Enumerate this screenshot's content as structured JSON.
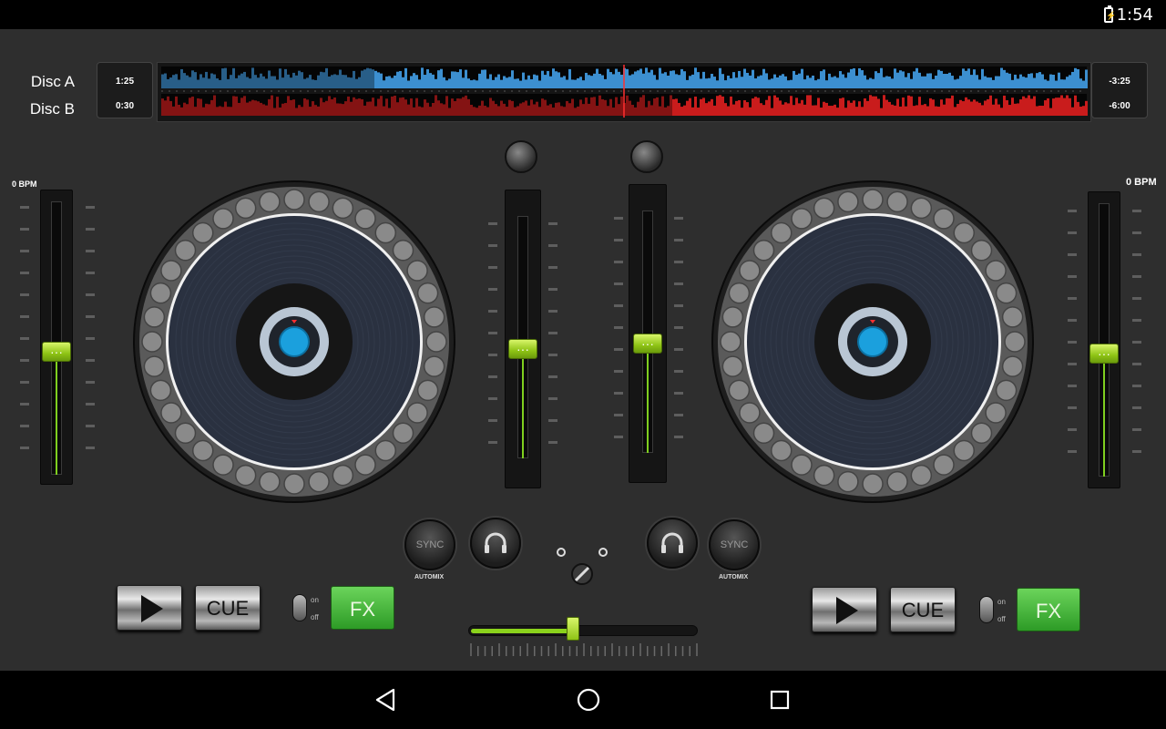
{
  "status": {
    "time": "1:54",
    "battery_icon": "battery-charging-icon"
  },
  "waveform": {
    "disc_a_label": "Disc A",
    "disc_b_label": "Disc B",
    "disc_a_elapsed": "1:25",
    "disc_b_elapsed": "0:30",
    "disc_a_remaining": "-3:25",
    "disc_b_remaining": "-6:00",
    "disc_a_progress": 0.23,
    "disc_b_progress": 0.55,
    "disc_a_color": "#3c8fd0",
    "disc_b_color": "#c91c1c",
    "playhead_color": "#ff3030"
  },
  "deck_a": {
    "bpm": "0 BPM",
    "pitch_fader_level": 0.45,
    "volume_fader_level": 0.45,
    "sync_label": "SYNC",
    "automix_label": "AUTOMIX",
    "cue_label": "CUE",
    "fx_label": "FX",
    "toggle_on": "on",
    "toggle_off": "off"
  },
  "deck_b": {
    "bpm": "0 BPM",
    "pitch_fader_level": 0.45,
    "volume_fader_level": 0.45,
    "sync_label": "SYNC",
    "automix_label": "AUTOMIX",
    "cue_label": "CUE",
    "fx_label": "FX",
    "toggle_on": "on",
    "toggle_off": "off"
  },
  "mixer": {
    "crossfader_level": 0.45,
    "accent": "#8ad21c"
  },
  "icons": [
    "play-icon",
    "headphones-icon",
    "shuffle-icon",
    "back-icon",
    "home-icon",
    "recents-icon"
  ]
}
